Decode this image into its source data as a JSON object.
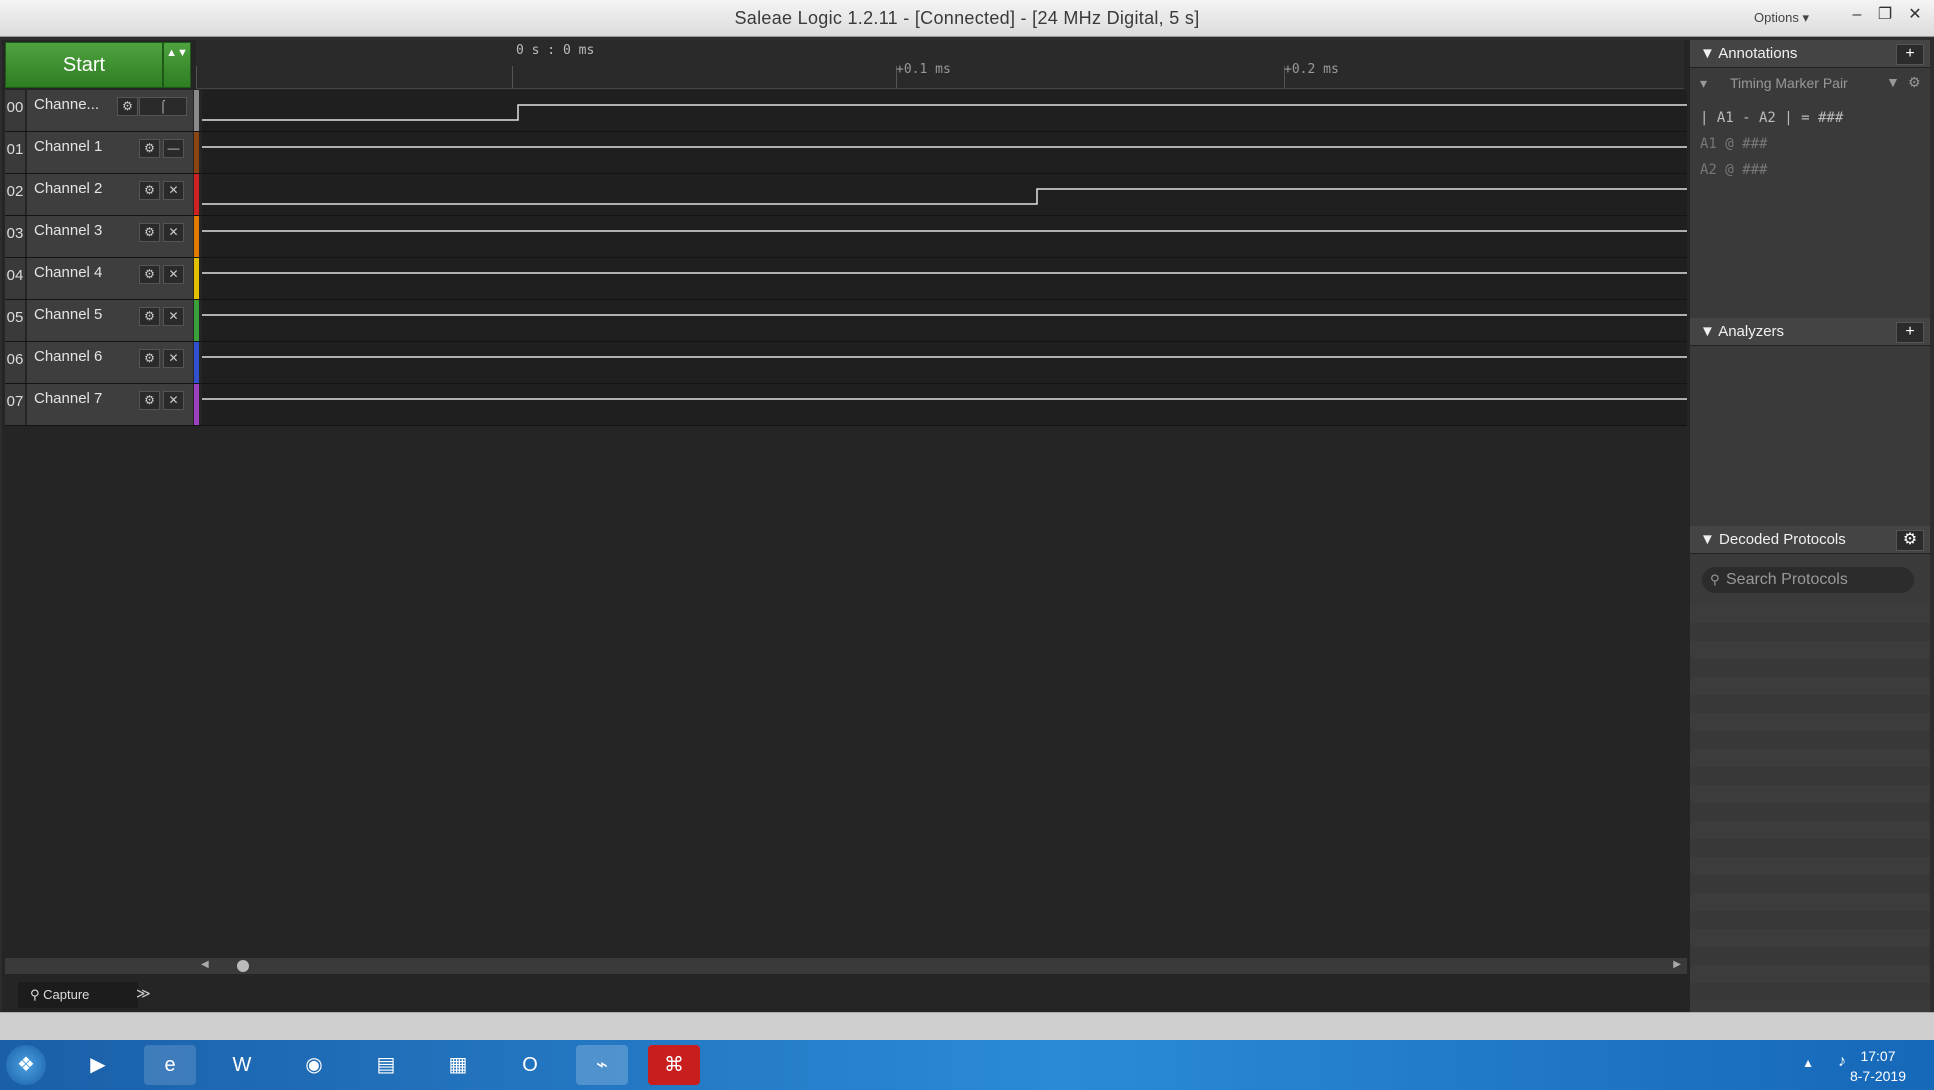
{
  "window": {
    "title": "Saleae Logic 1.2.11 - [Connected] - [24 MHz Digital, 5 s]",
    "options_label": "Options ▾",
    "minimize": "–",
    "restore": "❐",
    "close": "✕"
  },
  "toolbar": {
    "start_label": "Start",
    "start_arrows": "▲▼"
  },
  "timeline": {
    "origin_label": "0 s : 0 ms",
    "ticks": [
      "+0.1 ms",
      "+0.2 ms"
    ]
  },
  "channels": [
    {
      "num": "00",
      "label": "Channe...",
      "color": "#8a8a8a",
      "trigger": "⌠"
    },
    {
      "num": "01",
      "label": "Channel 1",
      "color": "#8b4513"
    },
    {
      "num": "02",
      "label": "Channel 2",
      "color": "#cc2222"
    },
    {
      "num": "03",
      "label": "Channel 3",
      "color": "#e07b00"
    },
    {
      "num": "04",
      "label": "Channel 4",
      "color": "#e0c000"
    },
    {
      "num": "05",
      "label": "Channel 5",
      "color": "#3aa03a"
    },
    {
      "num": "06",
      "label": "Channel 6",
      "color": "#3050d0"
    },
    {
      "num": "07",
      "label": "Channel 7",
      "color": "#9a40c0"
    }
  ],
  "icons": {
    "gear": "⚙",
    "close": "✕",
    "minus": "—"
  },
  "bottom": {
    "capture_tab": "Capture",
    "more": "≫"
  },
  "annotations": {
    "title": "Annotations",
    "plus": "+",
    "marker_pair": "Timing Marker Pair",
    "formula": "| A1 - A2 | = ###",
    "a1": "A1 @ ###",
    "a2": "A2 @ ###"
  },
  "analyzers": {
    "title": "Analyzers",
    "plus": "+"
  },
  "decoded": {
    "title": "Decoded Protocols",
    "search_placeholder": "Search Protocols"
  },
  "taskbar": {
    "time": "17:07",
    "date": "8-7-2019"
  }
}
